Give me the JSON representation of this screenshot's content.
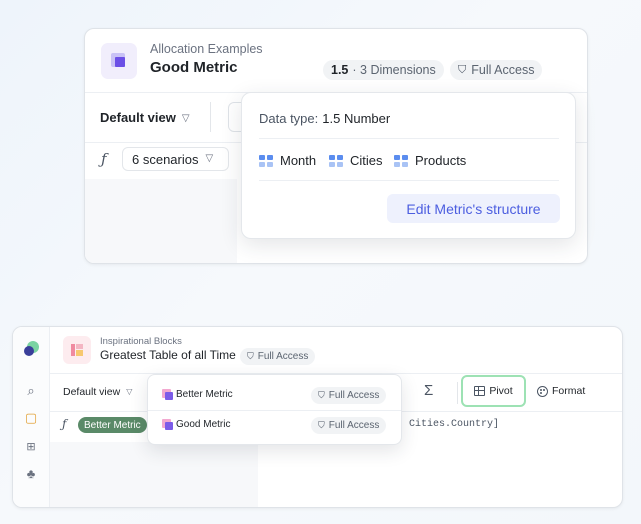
{
  "top_card": {
    "subtitle": "Allocation Examples",
    "title": "Good Metric",
    "version": "1.5",
    "dimensions": "· 3 Dimensions",
    "access": "Full Access",
    "default_view": "Default view",
    "scenarios": "6 scenarios",
    "fx": "ƒ"
  },
  "structure_popover": {
    "data_type_label": "Data type:",
    "data_type_value": "1.5 Number",
    "dimensions": [
      "Month",
      "Cities",
      "Products"
    ],
    "edit_button": "Edit Metric's structure"
  },
  "app": {
    "block_subtitle": "Inspirational Blocks",
    "block_title": "Greatest Table of all Time",
    "access": "Full Access",
    "default_view": "Default view",
    "sigma": "Σ",
    "pivot_label": "Pivot",
    "format_label": "Format",
    "fx": "ƒ",
    "formula_metric": "Better Metric",
    "formula_text": "Cities.Country]",
    "rail_icons": [
      "brand-logo",
      "search-icon",
      "blocks-icon",
      "apps-grid-icon",
      "org-tree-icon"
    ]
  },
  "metric_dropdown": {
    "items": [
      {
        "label": "Better Metric",
        "access": "Full Access"
      },
      {
        "label": "Good Metric",
        "access": "Full Access"
      }
    ]
  },
  "colors": {
    "accent": "#4c5ee0",
    "pivot_highlight": "#9de2b4",
    "metric_pill": "#5a8a68"
  }
}
